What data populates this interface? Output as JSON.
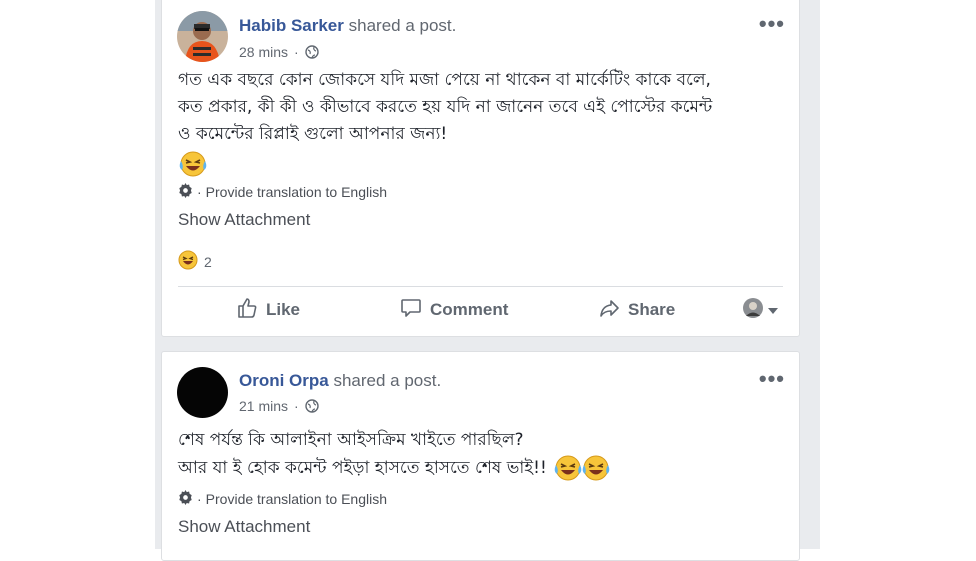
{
  "posts": [
    {
      "author": "Habib Sarker",
      "action": "shared a post.",
      "time": "28 mins",
      "text_lines": [
        "গত এক বছরে কোন জোকসে যদি মজা পেয়ে না থাকেন বা মার্কেটিং কাকে বলে,",
        "কত প্রকার, কী কী ও কীভাবে করতে হয় যদি না জানেন তবে এই পোস্টের কমেন্ট",
        "ও কমেন্টের রিপ্লাই গুলো আপনার জন্য!"
      ],
      "translate_text": "Provide translation to English",
      "show_attachment": "Show Attachment",
      "reaction_count": "2",
      "like_label": "Like",
      "comment_label": "Comment",
      "share_label": "Share"
    },
    {
      "author": "Oroni Orpa",
      "action": "shared a post.",
      "time": "21 mins",
      "text_lines": [
        "শেষ পর্যন্ত কি আলাইনা আইসক্রিম খাইতে পারছিল?",
        "আর যা ই হোক কমেন্ট পইড়া হাসতে হাসতে শেষ ভাই!!"
      ],
      "translate_text": "Provide translation to English",
      "show_attachment": "Show Attachment"
    }
  ],
  "colors": {
    "name_link": "#385898",
    "feed_bg": "#e9ebee",
    "secondary_text": "#616770"
  },
  "icons": {
    "more": "more-options-icon",
    "globe": "public-globe-icon",
    "gear": "gear-icon",
    "emoji": "laughing-emoji-icon",
    "like": "thumbs-up-icon",
    "comment": "comment-bubble-icon",
    "share": "share-arrow-icon"
  }
}
